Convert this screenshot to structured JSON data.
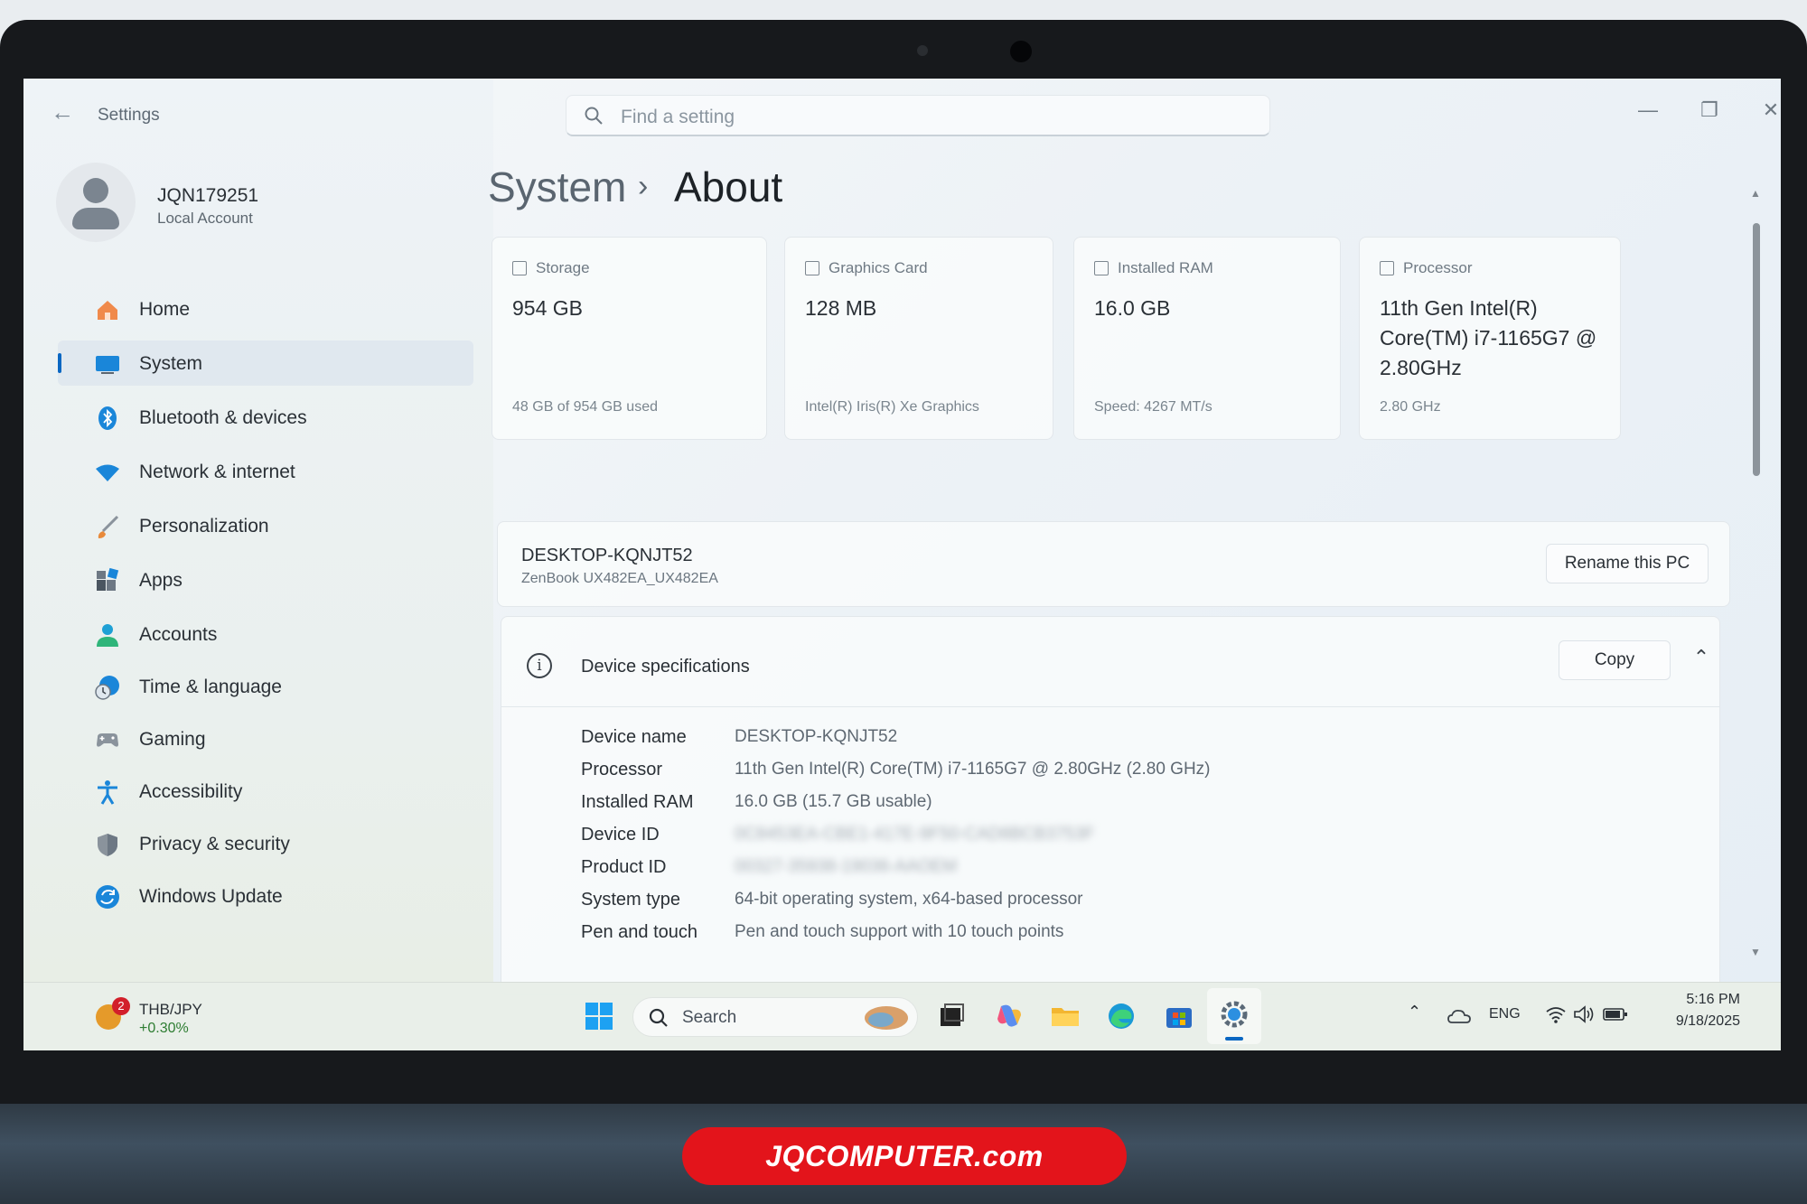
{
  "window": {
    "app_title": "Settings",
    "search_placeholder": "Find a setting"
  },
  "profile": {
    "name": "JQN179251",
    "account_type": "Local Account"
  },
  "sidebar": {
    "items": [
      {
        "label": "Home",
        "icon": "home-icon",
        "selected": false
      },
      {
        "label": "System",
        "icon": "monitor-icon",
        "selected": true
      },
      {
        "label": "Bluetooth & devices",
        "icon": "bluetooth-icon",
        "selected": false
      },
      {
        "label": "Network & internet",
        "icon": "wifi-icon",
        "selected": false
      },
      {
        "label": "Personalization",
        "icon": "brush-icon",
        "selected": false
      },
      {
        "label": "Apps",
        "icon": "apps-icon",
        "selected": false
      },
      {
        "label": "Accounts",
        "icon": "person-icon",
        "selected": false
      },
      {
        "label": "Time & language",
        "icon": "clock-globe-icon",
        "selected": false
      },
      {
        "label": "Gaming",
        "icon": "gamepad-icon",
        "selected": false
      },
      {
        "label": "Accessibility",
        "icon": "accessibility-icon",
        "selected": false
      },
      {
        "label": "Privacy & security",
        "icon": "shield-icon",
        "selected": false
      },
      {
        "label": "Windows Update",
        "icon": "update-icon",
        "selected": false
      }
    ]
  },
  "breadcrumb": {
    "parent": "System",
    "separator": "›",
    "current": "About"
  },
  "cards": [
    {
      "title": "Storage",
      "value": "954 GB",
      "footer": "48 GB of 954 GB used",
      "icon": "storage-icon"
    },
    {
      "title": "Graphics Card",
      "value": "128 MB",
      "footer": "Intel(R) Iris(R) Xe Graphics",
      "icon": "graphics-card-icon"
    },
    {
      "title": "Installed RAM",
      "value": "16.0 GB",
      "footer": "Speed: 4267 MT/s",
      "icon": "ram-icon"
    },
    {
      "title": "Processor",
      "value": "11th Gen Intel(R) Core(TM) i7-1165G7 @ 2.80GHz",
      "footer": "2.80 GHz",
      "icon": "processor-icon"
    }
  ],
  "pc": {
    "name": "DESKTOP-KQNJT52",
    "model": "ZenBook UX482EA_UX482EA",
    "rename_label": "Rename this PC"
  },
  "specs": {
    "title": "Device specifications",
    "copy_label": "Copy",
    "rows": [
      {
        "key": "Device name",
        "value": "DESKTOP-KQNJT52",
        "blurred": false
      },
      {
        "key": "Processor",
        "value": "11th Gen Intel(R) Core(TM) i7-1165G7 @ 2.80GHz (2.80 GHz)",
        "blurred": false
      },
      {
        "key": "Installed RAM",
        "value": "16.0 GB (15.7 GB usable)",
        "blurred": false
      },
      {
        "key": "Device ID",
        "value": "0C8453EA-CBE1-417E-9F50-CAD8BCB3753F",
        "blurred": true
      },
      {
        "key": "Product ID",
        "value": "00327-35938-19036-AAOEM",
        "blurred": true
      },
      {
        "key": "System type",
        "value": "64-bit operating system, x64-based processor",
        "blurred": false
      },
      {
        "key": "Pen and touch",
        "value": "Pen and touch support with 10 touch points",
        "blurred": false
      }
    ]
  },
  "taskbar": {
    "widget_title": "THB/JPY",
    "widget_value": "+0.30%",
    "widget_badge": "2",
    "search_label": "Search",
    "language": "ENG",
    "time": "5:16 PM",
    "date": "9/18/2025"
  },
  "watermark": "JQCOMPUTER.com",
  "colors": {
    "accent": "#0a67c2",
    "watermark_bg": "#e3141b",
    "widget_positive": "#2e7d32"
  }
}
